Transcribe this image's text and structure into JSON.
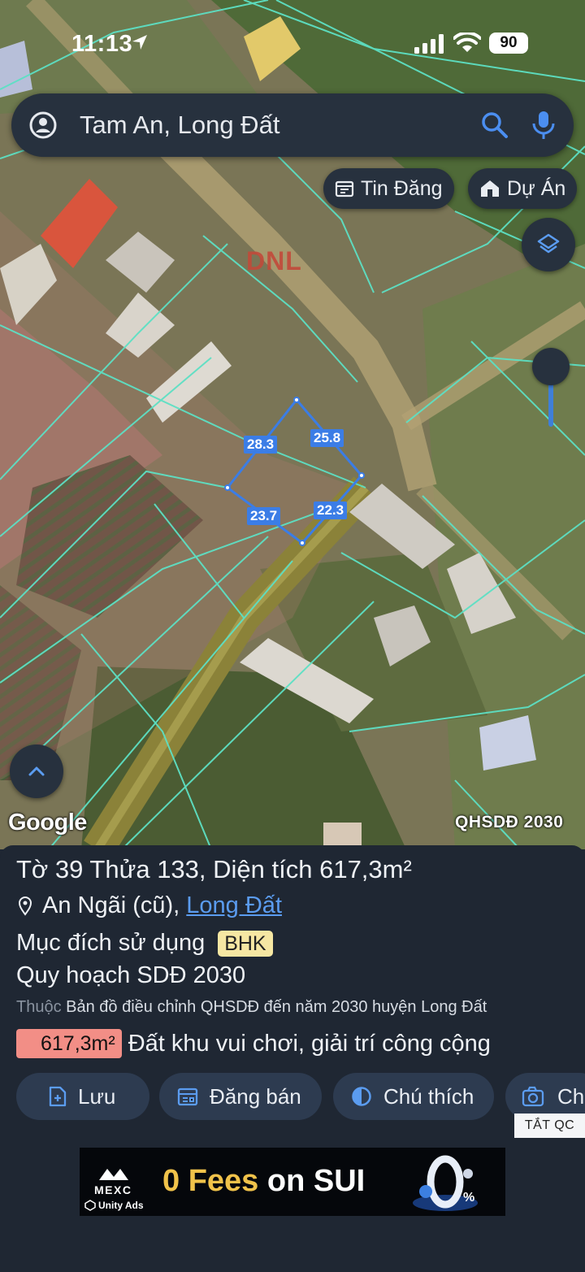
{
  "status_bar": {
    "time": "11:13",
    "battery": "90"
  },
  "search": {
    "value": "Tam An, Long Đất"
  },
  "map_chips": {
    "listings_label": "Tin Đăng",
    "projects_label": "Dự Án"
  },
  "map": {
    "zone_code": "DNL",
    "parcel_edges": [
      "28.3",
      "25.8",
      "23.7",
      "22.3"
    ],
    "attribution": "Google",
    "plan_layer": "QHSDĐ 2030",
    "zoom_level": 0.9
  },
  "parcel": {
    "title": "Tờ 39 Thửa 133, Diện tích 617,3m²",
    "ward_old": "An Ngãi (cũ),",
    "district_link": "Long Đất",
    "purpose_label": "Mục đích sử dụng",
    "purpose_code": "BHK",
    "plan_title": "Quy hoạch SDĐ 2030",
    "source_prefix": "Thuộc",
    "source_text": "Bản đồ điều chỉnh QHSDĐ đến năm 2030 huyện Long Đất",
    "landuse_area": "617,3m²",
    "landuse_name": "Đất khu vui chơi, giải trí công cộng",
    "landuse_color": "#f28e86"
  },
  "actions": {
    "save": "Lưu",
    "post_sale": "Đăng bán",
    "legend": "Chú thích",
    "capture": "Ch"
  },
  "ads": {
    "hide_label": "TẮT QC",
    "brand": "MEXC",
    "network": "Unity Ads",
    "headline_a": "0 Fees",
    "headline_b": "on SUI"
  },
  "colors": {
    "panel_bg": "#1f2733",
    "button_bg": "#2d3b50",
    "accent_blue": "#3b7de6",
    "link_blue": "#5b9cf0",
    "parcel_lines": "#5de0c4",
    "badge_yellow": "#f6e7a3"
  }
}
